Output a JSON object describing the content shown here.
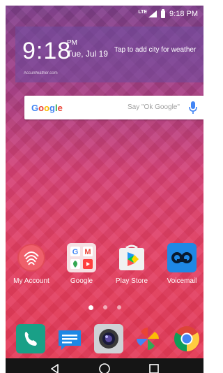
{
  "status_bar": {
    "time": "9:18 PM",
    "network": "LTE"
  },
  "weather_widget": {
    "time": "9:18",
    "ampm": "PM",
    "date": "Tue, Jul 19",
    "cta": "Tap to add city for weather",
    "source": "AccuWeather.com"
  },
  "search": {
    "brand": "Google",
    "hint": "Say \"Ok Google\""
  },
  "apps": [
    {
      "label": "My Account"
    },
    {
      "label": "Google"
    },
    {
      "label": "Play Store"
    },
    {
      "label": "Voicemail"
    }
  ],
  "page_indicator": {
    "count": 3,
    "active": 1
  },
  "dock": [
    "phone-icon",
    "messages-icon",
    "camera-icon",
    "photos-icon",
    "chrome-icon"
  ],
  "navigation": [
    "back-icon",
    "home-icon",
    "recents-icon"
  ],
  "colors": {
    "accent": "#d94269",
    "search_mic": "#4285F4"
  }
}
